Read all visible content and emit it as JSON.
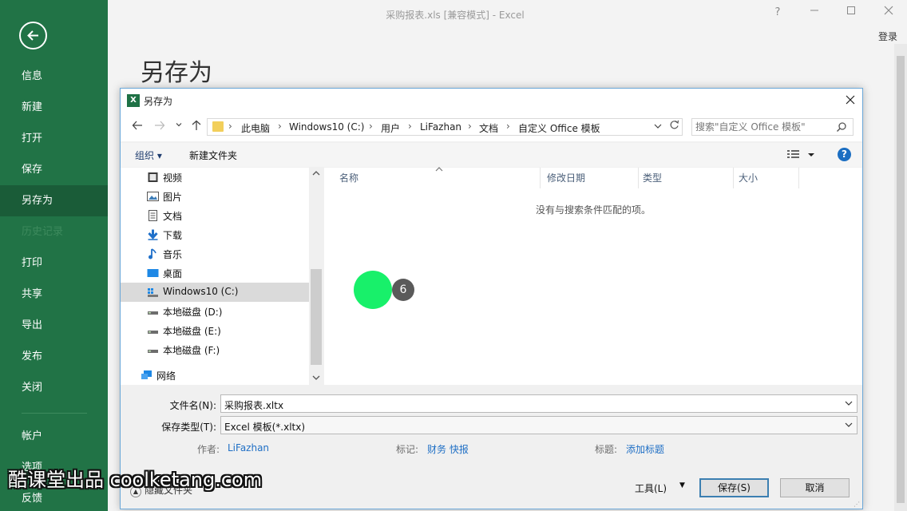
{
  "window": {
    "title": "采购报表.xls  [兼容模式] - Excel",
    "help": "?",
    "sign_in": "登录"
  },
  "backstage": {
    "heading": "另存为",
    "nav": [
      "信息",
      "新建",
      "打开",
      "保存",
      "另存为",
      "历史记录",
      "打印",
      "共享",
      "导出",
      "发布",
      "关闭",
      "帐户",
      "选项",
      "反馈"
    ],
    "active": "另存为",
    "disabled": "历史记录"
  },
  "dialog": {
    "title": "另存为",
    "breadcrumb": [
      "此电脑",
      "Windows10 (C:)",
      "用户",
      "LiFazhan",
      "文档",
      "自定义 Office 模板"
    ],
    "search_placeholder": "搜索\"自定义 Office 模板\"",
    "toolbar": {
      "organize": "组织 ▾",
      "new_folder": "新建文件夹"
    },
    "tree": [
      {
        "label": "视频",
        "icon": "video-icon"
      },
      {
        "label": "图片",
        "icon": "pictures-icon"
      },
      {
        "label": "文档",
        "icon": "documents-icon"
      },
      {
        "label": "下载",
        "icon": "download-icon"
      },
      {
        "label": "音乐",
        "icon": "music-icon"
      },
      {
        "label": "桌面",
        "icon": "desktop-icon"
      },
      {
        "label": "Windows10 (C:)",
        "icon": "system-drive-icon",
        "selected": true
      },
      {
        "label": "本地磁盘 (D:)",
        "icon": "drive-icon"
      },
      {
        "label": "本地磁盘 (E:)",
        "icon": "drive-icon"
      },
      {
        "label": "本地磁盘 (F:)",
        "icon": "drive-icon"
      },
      {
        "label": "网络",
        "icon": "network-icon"
      }
    ],
    "columns": [
      "名称",
      "修改日期",
      "类型",
      "大小"
    ],
    "empty_message": "没有与搜索条件匹配的项。",
    "filename_label": "文件名(N):",
    "filename": "采购报表.xltx",
    "filetype_label": "保存类型(T):",
    "filetype": "Excel 模板(*.xltx)",
    "author_label": "作者:",
    "author": "LiFazhan",
    "tags_label": "标记:",
    "tags": "财务 快报",
    "title_label": "标题:",
    "title_value": "添加标题",
    "hide_folders": "隐藏文件夹",
    "tools": "工具(L)",
    "save": "保存(S)",
    "cancel": "取消"
  },
  "overlay": {
    "step": "6",
    "watermark": "酷课堂出品 coolketang.com"
  }
}
